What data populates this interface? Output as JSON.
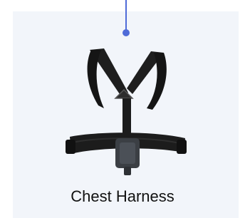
{
  "product": {
    "label": "Chest Harness",
    "image_icon": "chest-harness-image"
  },
  "colors": {
    "connector": "#4f6bd8",
    "card_background": "#f2f5fa",
    "strap": "#1c1c1c",
    "mount": "#3b3f44"
  }
}
